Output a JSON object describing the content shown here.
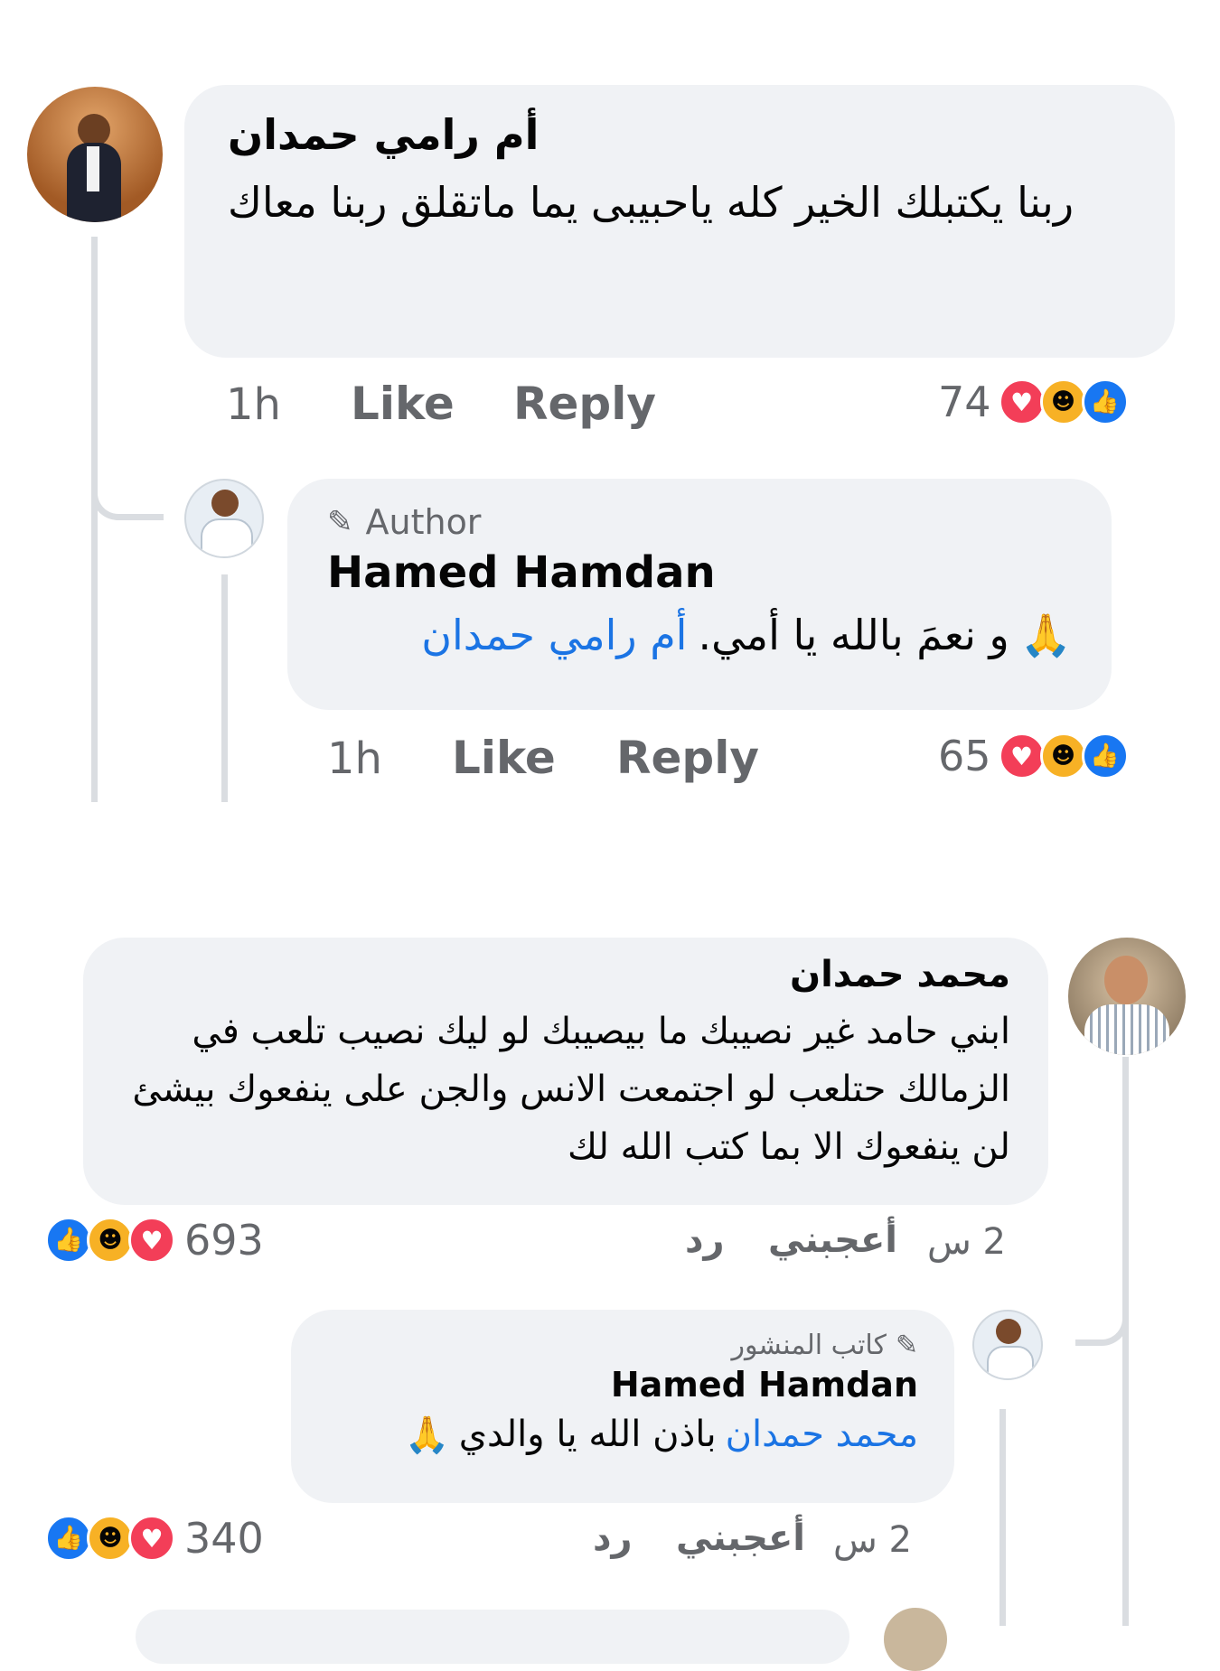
{
  "comment1": {
    "author": "أم رامي حمدان",
    "text": "ربنا يكتبلك الخير كله ياحبيبى يما ماتقلق ربنا معاك",
    "time": "1h",
    "like": "Like",
    "reply": "Reply",
    "reactions": "74"
  },
  "reply1": {
    "badge": "Author",
    "author": "Hamed Hamdan",
    "mention": "أم رامي حمدان",
    "text": "و نعمَ بالله يا أمي.",
    "emoji": "🙏",
    "time": "1h",
    "like": "Like",
    "reply": "Reply",
    "reactions": "65"
  },
  "comment2": {
    "author": "محمد حمدان",
    "text": "ابني حامد غير نصيبك ما بيصيبك لو ليك نصيب تلعب في الزمالك حتلعب لو اجتمعت الانس والجن على ينفعوك بيشئ لن  ينفعوك الا بما كتب الله لك",
    "time": "2 س",
    "like": "أعجبني",
    "reply": "رد",
    "reactions": "693"
  },
  "reply2": {
    "badge": "كاتب المنشور",
    "author": "Hamed Hamdan",
    "mention": "محمد حمدان",
    "text": "باذن الله يا والدي",
    "emoji": "🙏",
    "time": "2 س",
    "like": "أعجبني",
    "reply": "رد",
    "reactions": "340"
  },
  "colors": {
    "bubble": "#f0f2f5",
    "link": "#1b74e4",
    "meta": "#65676b",
    "like": "#1877f2",
    "love": "#f33e58",
    "care": "#f7b125"
  },
  "icons": [
    "like-reaction-icon",
    "care-reaction-icon",
    "love-reaction-icon",
    "pencil-icon",
    "pray-emoji"
  ]
}
